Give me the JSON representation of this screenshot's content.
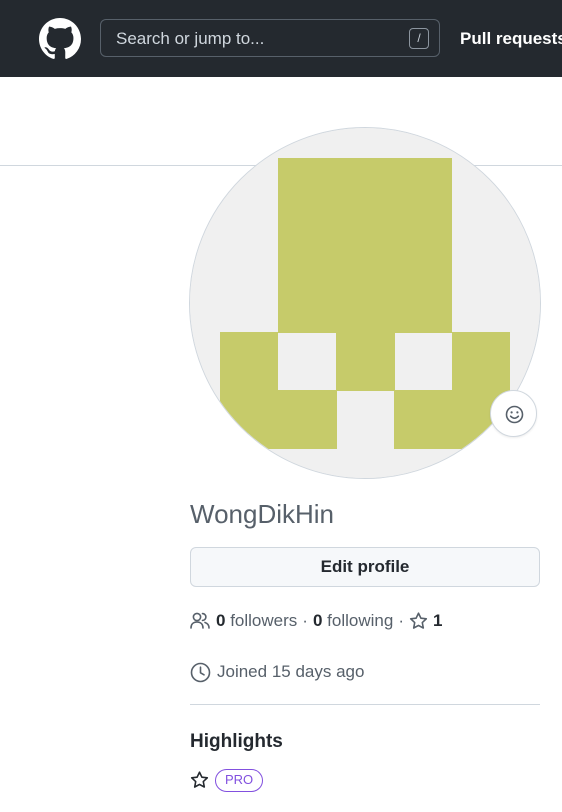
{
  "header": {
    "logo_icon": "github-mark-icon",
    "search": {
      "placeholder": "Search or jump to...",
      "shortcut": "/"
    },
    "nav_items": [
      {
        "label": "Pull requests"
      }
    ]
  },
  "profile": {
    "username": "WongDikHin",
    "avatar_color": "#c6cb6a",
    "avatar_bg": "#f0f0f0",
    "status_icon": "smiley-icon",
    "edit_label": "Edit profile",
    "followers_count": "0",
    "followers_label": "followers",
    "separator": "·",
    "following_count": "0",
    "following_label": "following",
    "stars_count": "1",
    "people_icon": "people-icon",
    "star_icon": "star-icon",
    "joined_icon": "clock-icon",
    "joined_text": "Joined 15 days ago",
    "highlights": {
      "title": "Highlights",
      "badge_icon": "star-icon",
      "badge_label": "PRO"
    }
  },
  "colors": {
    "header_bg": "#24292f",
    "accent_purple": "#8250df",
    "text_muted": "#57606a"
  }
}
